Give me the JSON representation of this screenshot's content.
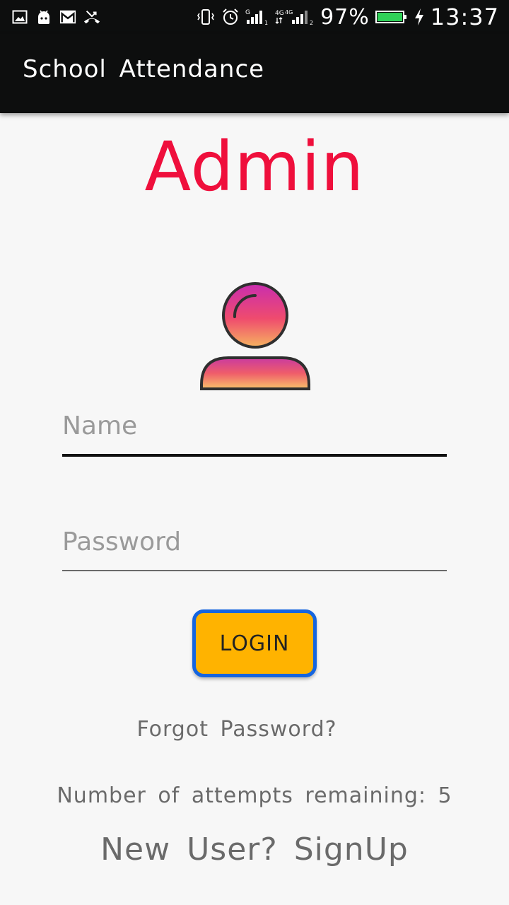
{
  "status_bar": {
    "left_icons": [
      "image-icon",
      "android-icon",
      "gmail-icon",
      "missed-call-icon"
    ],
    "right_icons": [
      "vibrate-icon",
      "alarm-icon",
      "signal-g-icon",
      "signal-4g-icon"
    ],
    "battery_percent": "97%",
    "time": "13:37"
  },
  "app_bar": {
    "title": "School Attendance"
  },
  "main": {
    "heading": "Admin",
    "name_field": {
      "placeholder": "Name",
      "value": ""
    },
    "password_field": {
      "placeholder": "Password",
      "value": ""
    },
    "login_label": "LOGIN",
    "forgot_password": "Forgot Password?",
    "attempts_text": "Number of attempts remaining: 5",
    "signup_text": "New User? SignUp"
  },
  "colors": {
    "app_bar": "#0d0e0e",
    "heading": "#ef0f3c",
    "login_button": "#ffb300",
    "login_border": "#1565e0",
    "battery": "#30d158"
  }
}
